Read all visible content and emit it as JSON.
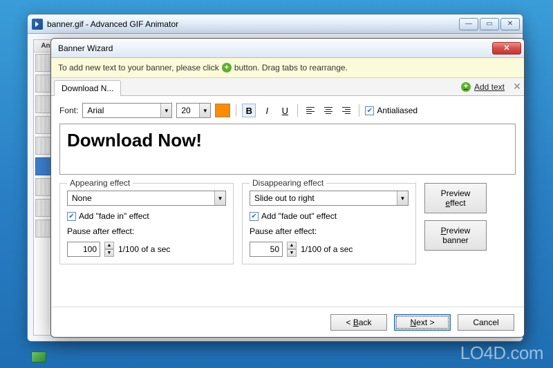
{
  "main_window": {
    "title": "banner.gif - Advanced GIF Animator",
    "left_header": "An"
  },
  "dialog": {
    "title": "Banner Wizard",
    "help_pre": "To add new text to your banner, please click",
    "help_post": "button. Drag tabs to rearrange.",
    "tab_label": "Download N...",
    "add_text_label": "Add text",
    "font_label": "Font:",
    "font_value": "Arial",
    "font_size": "20",
    "bold": "B",
    "italic": "I",
    "underline": "U",
    "antialiased": "Antialiased",
    "preview_text": "Download Now!",
    "appear": {
      "legend": "Appearing effect",
      "value": "None",
      "fade_label": "Add \"fade in\" effect",
      "pause_label": "Pause after effect:",
      "pause_value": "100",
      "pause_unit": "1/100 of a sec"
    },
    "disappear": {
      "legend": "Disappearing effect",
      "value": "Slide out to right",
      "fade_label": "Add \"fade out\" effect",
      "pause_label": "Pause after effect:",
      "pause_value": "50",
      "pause_unit": "1/100 of a sec"
    },
    "preview_effect": "Preview effect",
    "preview_banner": "Preview banner",
    "back": "< Back",
    "next": "Next >",
    "cancel": "Cancel"
  },
  "watermark": "LO4D.com",
  "colors": {
    "swatch": "#ff8c00"
  }
}
